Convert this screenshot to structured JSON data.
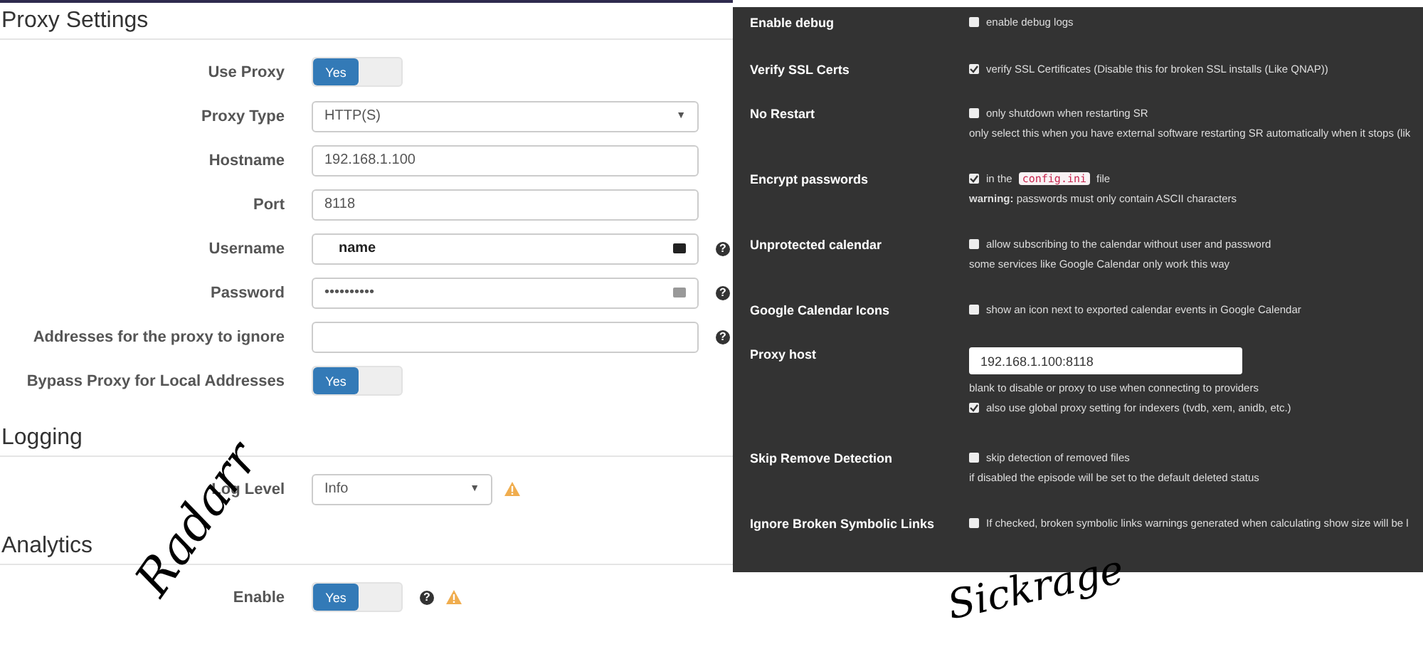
{
  "radarr": {
    "sections": [
      {
        "title": "Proxy Settings",
        "rows": [
          {
            "kind": "toggle",
            "label": "Use Proxy",
            "value": "Yes",
            "on": true
          },
          {
            "kind": "select",
            "label": "Proxy Type",
            "value": "HTTP(S)",
            "caret": "▼"
          },
          {
            "kind": "input",
            "label": "Hostname",
            "value": "192.168.1.100"
          },
          {
            "kind": "input",
            "label": "Port",
            "value": "8118"
          },
          {
            "kind": "input",
            "label": "Username",
            "value": "name",
            "help": "?",
            "key_icon": true
          },
          {
            "kind": "password",
            "label": "Password",
            "value": "••••••••••",
            "help": "?",
            "key_icon": true
          },
          {
            "kind": "input",
            "label": "Addresses for the proxy to ignore",
            "value": "",
            "help": "?"
          },
          {
            "kind": "toggle",
            "label": "Bypass Proxy for Local Addresses",
            "value": "Yes",
            "on": true
          }
        ]
      },
      {
        "title": "Logging",
        "rows": [
          {
            "kind": "short-select",
            "label": "Log Level",
            "value": "Info",
            "caret": "▼",
            "warning": true
          }
        ]
      },
      {
        "title": "Analytics",
        "rows": [
          {
            "kind": "toggle",
            "label": "Enable",
            "value": "Yes",
            "on": true,
            "help": "?",
            "warning": true
          }
        ]
      }
    ]
  },
  "sickrage": {
    "rows": [
      {
        "label": "Enable debug",
        "checkbox": {
          "checked": false,
          "text": "enable debug logs"
        }
      },
      {
        "label": "Verify SSL Certs",
        "checkbox": {
          "checked": true,
          "text": "verify SSL Certificates (Disable this for broken SSL installs (Like QNAP))"
        }
      },
      {
        "label": "No Restart",
        "checkbox": {
          "checked": false,
          "text": "only shutdown when restarting SR"
        },
        "note": "only select this when you have external software restarting SR automatically when it stops (lik"
      },
      {
        "label": "Encrypt passwords",
        "checkbox": {
          "checked": true,
          "text": "in the",
          "code": "config.ini",
          "text_after": "file"
        },
        "note": "**warning:** passwords must only contain ASCII characters"
      },
      {
        "label": "Unprotected calendar",
        "checkbox": {
          "checked": false,
          "text": "allow subscribing to the calendar without user and password"
        },
        "note": "some services like Google Calendar only work this way"
      },
      {
        "label": "Google Calendar Icons",
        "checkbox": {
          "checked": false,
          "text": "show an icon next to exported calendar events in Google Calendar"
        }
      },
      {
        "label": "Proxy host",
        "input": "192.168.1.100:8118",
        "note": "blank to disable or proxy to use when connecting to providers",
        "checkbox_after": {
          "checked": true,
          "text": "also use global proxy setting for indexers (tvdb, xem, anidb, etc.)"
        }
      },
      {
        "label": "Skip Remove Detection",
        "checkbox": {
          "checked": false,
          "text": "skip detection of removed files"
        },
        "note": "if disabled the episode will be set to the default deleted status"
      },
      {
        "label": "Ignore Broken Symbolic Links",
        "checkbox": {
          "checked": false,
          "text": "If checked, broken symbolic links warnings generated when calculating show size will be l"
        }
      }
    ]
  },
  "handwriting": [
    {
      "text": "Radarr"
    },
    {
      "text": "Sickrage"
    }
  ]
}
